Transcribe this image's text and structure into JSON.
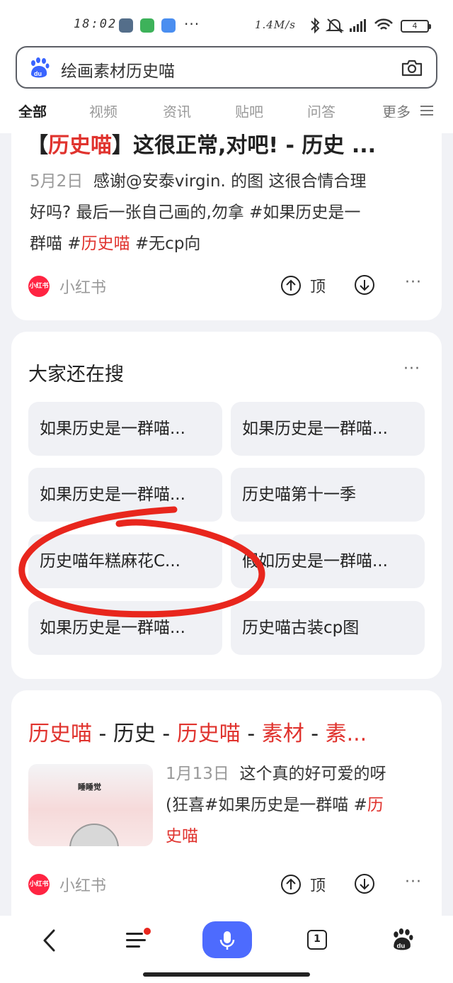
{
  "status": {
    "time": "18:02",
    "dots": "···",
    "speed": "1.4M/s",
    "battery": "4"
  },
  "search": {
    "query": "绘画素材历史喵",
    "brand_color": "#3964ff"
  },
  "tabs": {
    "items": [
      "全部",
      "视频",
      "资讯",
      "贴吧",
      "问答"
    ],
    "more": "更多"
  },
  "result1": {
    "title_pre": "【",
    "title_hl": "历史喵",
    "title_post": "】这很正常,对吧! - 历史 ...",
    "date": "5月2日",
    "line1": "感谢@安泰virgin. 的图 这很合情合理",
    "line2": "好吗? 最后一张自己画的,勿拿 #如果历史是一",
    "line3_pre": "群喵 #",
    "line3_hl": "历史喵",
    "line3_post": " #无cp向",
    "source_logo": "小红书",
    "source": "小红书",
    "vote_up": "顶",
    "more": "···"
  },
  "related": {
    "heading": "大家还在搜",
    "more": "···",
    "chips": [
      "如果历史是一群喵...",
      "如果历史是一群喵...",
      "如果历史是一群喵...",
      "历史喵第十一季",
      "历史喵年糕麻花C...",
      "假如历史是一群喵...",
      "如果历史是一群喵...",
      "历史喵古装cp图"
    ]
  },
  "result2": {
    "t1": "历史喵",
    "t2": " - 历史 - ",
    "t3": "历史喵",
    "t4": " - ",
    "t5": "素材",
    "t6": " - ",
    "t7": "素...",
    "thumb_label": "睡睡觉",
    "date": "1月13日",
    "line1": "这个真的好可爱的呀",
    "line2_pre": "(狂喜#如果历史是一群喵 #",
    "line2_hl": "历",
    "line3_hl": "史喵",
    "source_logo": "小红书",
    "source": "小红书",
    "vote_up": "顶",
    "more": "···"
  },
  "bottom_nav": {
    "tab_count": "1"
  },
  "annotation_color": "#e8261d"
}
